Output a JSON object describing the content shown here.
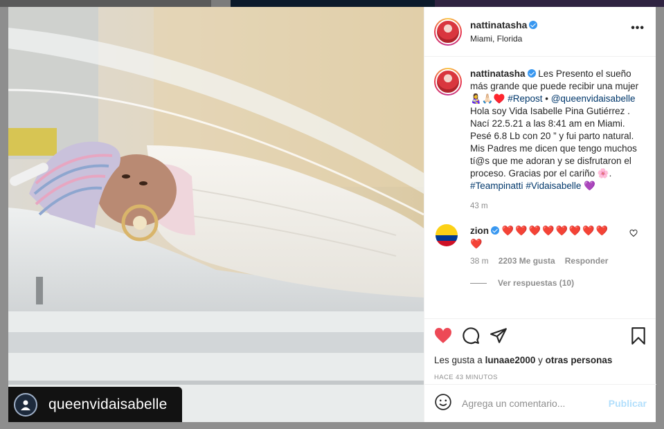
{
  "post": {
    "username": "nattinatasha",
    "location": "Miami, Florida",
    "more_icon": "more-options-icon",
    "watermark": "queenvidaisabelle"
  },
  "caption": {
    "username": "nattinatasha",
    "text_1": "Les Presento el sueño más grande que puede recibir una mujer 👩‍🍼🙏🏻♥️ ",
    "tag_repost": "#Repost",
    "text_2": " • ",
    "mention": "@queenvidaisabelle",
    "text_3": " Hola soy Vida Isabelle Pina Gutiérrez . Nací 22.5.21 a las 8:41 am en Miami. Pesé 6.8 Lb con 20 ” y fui parto natural. Mis Padres me dicen que tengo muchos tí@s que me adoran y se disfrutaron el proceso. Gracias por el cariño 🌸. ",
    "tag_1": "#Teampinatti",
    "tag_2": "#Vidaisabelle",
    "emoji_end": " 💜",
    "ago": "43 m"
  },
  "comment": {
    "username": "zion",
    "hearts": "❤️❤️❤️❤️❤️❤️❤️❤️❤️",
    "time": "38 m",
    "likes": "2203 Me gusta",
    "reply": "Responder",
    "view_replies": "Ver respuestas (10)"
  },
  "actions": {
    "likes_prefix": "Les gusta a ",
    "likes_user": "lunaae2000",
    "likes_mid": " y ",
    "likes_others": "otras personas",
    "time_ago": "HACE 43 MINUTOS"
  },
  "add_comment": {
    "placeholder": "Agrega un comentario...",
    "publish": "Publicar"
  },
  "colors": {
    "like_red": "#ed4956",
    "link_blue": "#00376b",
    "verified_blue": "#3897f0",
    "publish_disabled": "#b2dffc"
  }
}
